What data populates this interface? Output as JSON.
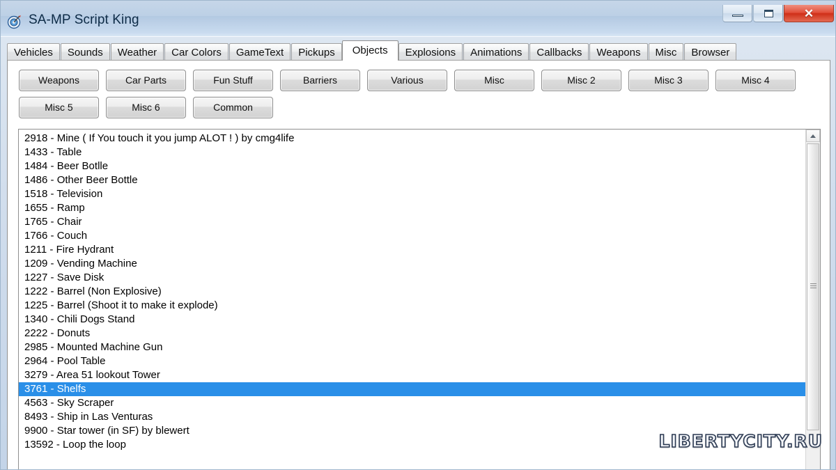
{
  "window": {
    "title": "SA-MP Script King",
    "icon": "target-dart-icon",
    "controls": {
      "minimize_label": "–",
      "maximize_label": "□",
      "close_label": "✕"
    }
  },
  "tabs": [
    {
      "label": "Vehicles",
      "selected": false
    },
    {
      "label": "Sounds",
      "selected": false
    },
    {
      "label": "Weather",
      "selected": false
    },
    {
      "label": "Car Colors",
      "selected": false
    },
    {
      "label": "GameText",
      "selected": false
    },
    {
      "label": "Pickups",
      "selected": false
    },
    {
      "label": "Objects",
      "selected": true
    },
    {
      "label": "Explosions",
      "selected": false
    },
    {
      "label": "Animations",
      "selected": false
    },
    {
      "label": "Callbacks",
      "selected": false
    },
    {
      "label": "Weapons",
      "selected": false
    },
    {
      "label": "Misc",
      "selected": false
    },
    {
      "label": "Browser",
      "selected": false
    }
  ],
  "category_buttons": {
    "row1": [
      "Weapons",
      "Car Parts",
      "Fun Stuff",
      "Barriers",
      "Various",
      "Misc",
      "Misc 2",
      "Misc 3",
      "Misc 4"
    ],
    "row2": [
      "Misc 5",
      "Misc 6",
      "Common"
    ]
  },
  "object_list": {
    "selected_index": 18,
    "items": [
      "2918 - Mine ( If You touch it you jump ALOT ! )  by cmg4life",
      "1433 - Table",
      "1484 - Beer Botlle",
      "1486 - Other Beer Bottle",
      "1518 - Television",
      "1655 - Ramp",
      "1765 - Chair",
      "1766 - Couch",
      "1211 - Fire Hydrant",
      "1209 - Vending Machine",
      "1227 - Save Disk",
      "1222 - Barrel (Non Explosive)",
      "1225 - Barrel (Shoot it to make it explode)",
      "1340 - Chili Dogs Stand",
      "2222 - Donuts",
      "2985 - Mounted Machine Gun",
      "2964 - Pool Table",
      "3279 - Area 51 lookout Tower",
      "3761 - Shelfs",
      "4563 - Sky Scraper",
      "8493 - Ship in Las Venturas",
      "9900 - Star tower (in SF) by blewert",
      "13592 - Loop the loop"
    ]
  },
  "scrollbar": {
    "up_arrow": "scroll-up-arrow",
    "thumb": "scroll-thumb"
  },
  "watermark": {
    "text": "LIBERTYCITY.RU"
  },
  "colors": {
    "selection": "#2a8fe8",
    "titlebar_top": "#c6d6e8",
    "close_button": "#cf2f18",
    "panel_background": "#ffffff"
  }
}
